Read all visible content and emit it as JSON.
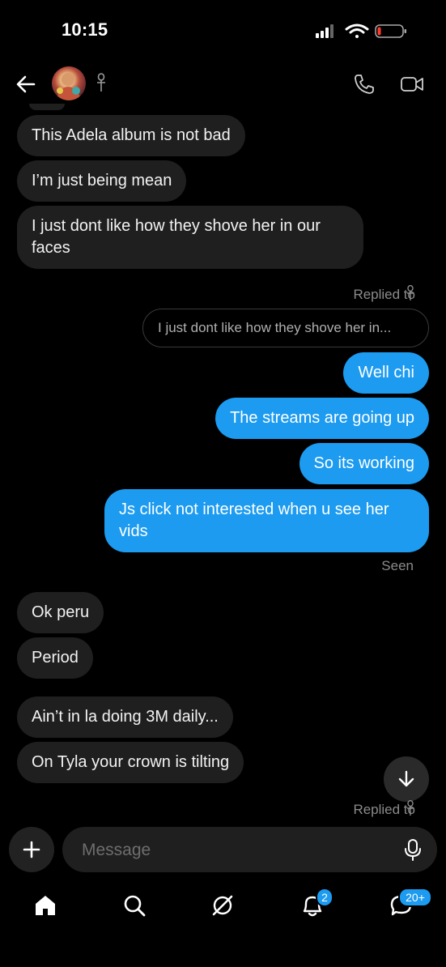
{
  "status_bar": {
    "time": "10:15"
  },
  "header": {
    "back_icon": "arrow-left-icon",
    "call_icon": "phone-icon",
    "video_icon": "video-camera-icon"
  },
  "messages": {
    "in_1": "This Adela album is not bad",
    "in_2": "I’m just being mean",
    "in_3": "I just dont like how they shove her in our faces",
    "replied_to_1": "Replied to",
    "reply_quote": "I just dont like how they shove her in...",
    "out_1": "Well chi",
    "out_2": "The streams are going up",
    "out_3": "So its working",
    "out_4": "Js click not interested when u see her vids",
    "seen": "Seen",
    "in_4": "Ok peru",
    "in_5": "Period",
    "in_6": "Ain’t in la doing 3M daily...",
    "in_7": "On Tyla your crown is tilting",
    "replied_to_2": "Replied to"
  },
  "composer": {
    "placeholder": "Message"
  },
  "bottom_nav": {
    "notifications_badge": "2",
    "messages_badge": "20+"
  },
  "colors": {
    "accent": "#1c9bf0",
    "incoming_bubble": "#1f1f1f",
    "background": "#000000"
  }
}
